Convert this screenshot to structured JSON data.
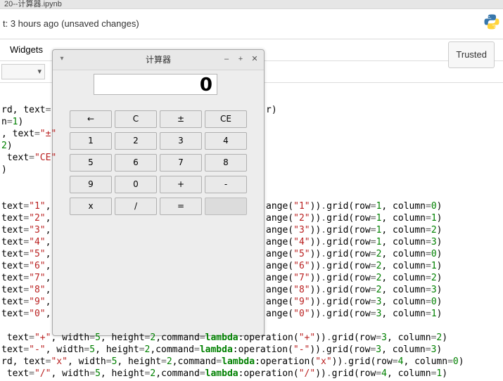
{
  "browser_tab": "20--计算器.ipynb",
  "status": "t: 3 hours ago (unsaved changes)",
  "menu": {
    "widgets": "Widgets",
    "trusted": "Trusted"
  },
  "code": {
    "l1": {
      "a": "rd, text=",
      "b": "r)"
    },
    "l2": "n=1)",
    "l3": {
      "a": ", text=",
      "s": "\"±\""
    },
    "l4": "2)",
    "l5": {
      "a": " text=",
      "s": "\"CE\""
    },
    "l6": ")",
    "t": [
      {
        "s": "\"1\"",
        "s2": "\"1\"",
        "r": "1",
        "c": "0"
      },
      {
        "s": "\"2\"",
        "s2": "\"2\"",
        "r": "1",
        "c": "1"
      },
      {
        "s": "\"3\"",
        "s2": "\"3\"",
        "r": "1",
        "c": "2"
      },
      {
        "s": "\"4\"",
        "s2": "\"4\"",
        "r": "1",
        "c": "3"
      },
      {
        "s": "\"5\"",
        "s2": "\"5\"",
        "r": "2",
        "c": "0"
      },
      {
        "s": "\"6\"",
        "s2": "\"6\"",
        "r": "2",
        "c": "1"
      },
      {
        "s": "\"7\"",
        "s2": "\"7\"",
        "r": "2",
        "c": "2"
      },
      {
        "s": "\"8\"",
        "s2": "\"8\"",
        "r": "2",
        "c": "3"
      },
      {
        "s": "\"9\"",
        "s2": "\"9\"",
        "r": "3",
        "c": "0"
      },
      {
        "s": "\"0\"",
        "s2": "\"0\"",
        "r": "3",
        "c": "1"
      }
    ],
    "ops": [
      {
        "pre": " text=",
        "s": "\"+\"",
        "mid": ", width=5, height=2,command=",
        "s2": "\"+\"",
        "r": "3",
        "c": "2"
      },
      {
        "pre": "text=",
        "s": "\"-\"",
        "mid": " , width=5, height=2,command=",
        "s2": "\"-\"",
        "r": "3",
        "c": "3"
      },
      {
        "pre": "rd, text=",
        "s": "\"x\"",
        "mid": ", width=5, height=2,command=",
        "s2": "\"x\"",
        "r": "4",
        "c": "0"
      },
      {
        "pre": " text=",
        "s": "\"/\"",
        "mid": ", width=5, height=2,command=",
        "s2": "\"/\"",
        "r": "4",
        "c": "1"
      }
    ],
    "textLabel": "text=",
    "angePrefix": "ange(",
    "gridPrefix": ")).grid(row=",
    "colPrefix": ", column=",
    "opPrefix": ":operation(",
    "lambda": "lambda",
    "dtextPrefix": "d, text="
  },
  "calc": {
    "title": "计算器",
    "display": "0",
    "buttons": [
      [
        "←",
        "C",
        "±",
        "CE"
      ],
      [
        "1",
        "2",
        "3",
        "4"
      ],
      [
        "5",
        "6",
        "7",
        "8"
      ],
      [
        "9",
        "0",
        "+",
        "-"
      ],
      [
        "x",
        "/",
        "=",
        ""
      ]
    ],
    "win": {
      "min": "–",
      "max": "+",
      "close": "✕"
    }
  }
}
